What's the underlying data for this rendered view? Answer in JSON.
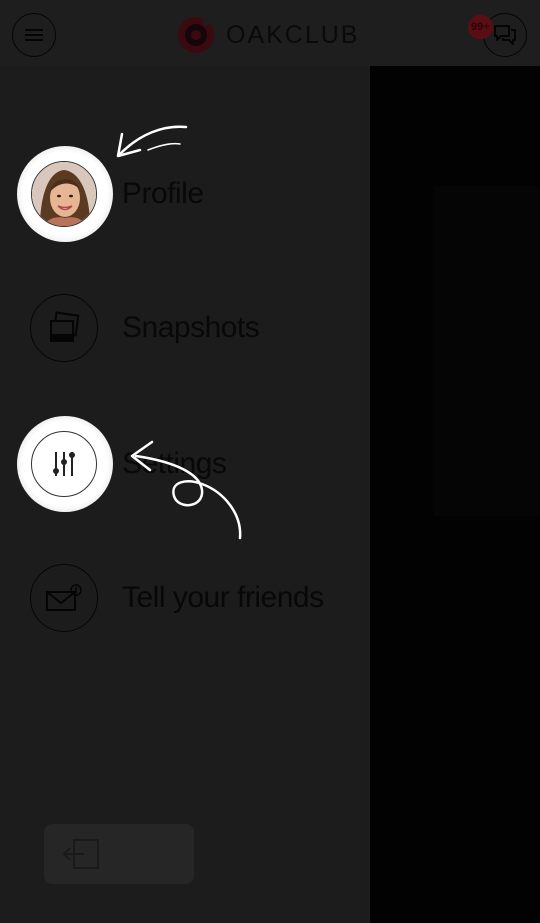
{
  "header": {
    "brand": "OAKCLUB",
    "notification_count": "99+",
    "icons": {
      "menu": "hamburger-menu-icon",
      "logo": "oakclub-logo-icon",
      "chat": "chat-bubbles-icon"
    }
  },
  "menu": {
    "items": [
      {
        "label": "Profile",
        "icon": "user-avatar"
      },
      {
        "label": "Snapshots",
        "icon": "photos-icon"
      },
      {
        "label": "Settings",
        "icon": "sliders-icon"
      },
      {
        "label": "Tell your friends",
        "icon": "envelope-icon"
      }
    ],
    "logout": {
      "label": "",
      "icon": "logout-icon"
    }
  },
  "colors": {
    "overlay_bg": "#1c1c1c",
    "highlight": "#ffffff",
    "brand_accent": "#5a0e14"
  }
}
